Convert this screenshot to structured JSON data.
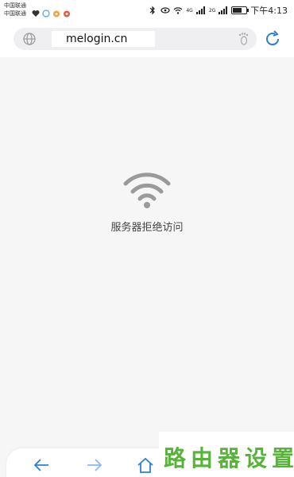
{
  "statusbar": {
    "carrier1": "中国联通",
    "carrier2": "中国联通",
    "network1": "4G",
    "network2": "2G",
    "battery_level": 0.7,
    "time": "下午4:13"
  },
  "address_bar": {
    "url": "melogin.cn"
  },
  "error_page": {
    "message": "服务器拒绝访问"
  },
  "watermark": {
    "text": "路由器设置"
  },
  "colors": {
    "accent": "#2a7fe0",
    "watermark": "#58b33a"
  }
}
